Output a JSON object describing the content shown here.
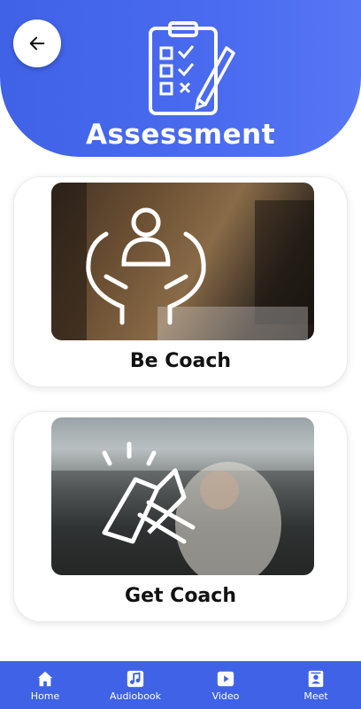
{
  "header": {
    "title": "Assessment",
    "back_icon": "arrow-left-icon",
    "header_icon": "checklist-clipboard-icon"
  },
  "cards": [
    {
      "label": "Be Coach",
      "icon": "hands-person-icon"
    },
    {
      "label": "Get Coach",
      "icon": "handshake-icon"
    }
  ],
  "bottom_nav": {
    "items": [
      {
        "label": "Home",
        "icon": "home-icon"
      },
      {
        "label": "Audiobook",
        "icon": "music-note-icon"
      },
      {
        "label": "Video",
        "icon": "video-play-icon"
      },
      {
        "label": "Meet",
        "icon": "contact-card-icon"
      }
    ]
  },
  "colors": {
    "primary": "#3f62e6",
    "card_bg": "#ffffff",
    "text": "#111111"
  }
}
